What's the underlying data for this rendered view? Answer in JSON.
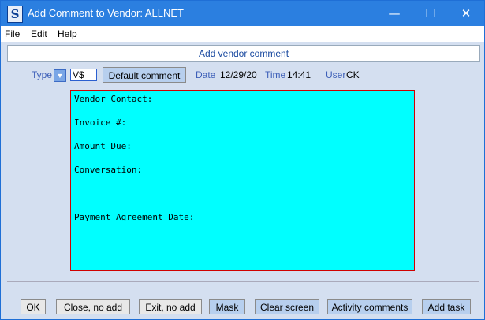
{
  "window": {
    "title": "Add Comment to Vendor:  ALLNET",
    "app_icon_letter": "S",
    "min_glyph": "—",
    "max_glyph": "☐",
    "close_glyph": "✕"
  },
  "menu": {
    "file": "File",
    "edit": "Edit",
    "help": "Help"
  },
  "header": {
    "label": "Add vendor comment"
  },
  "fields": {
    "type_label": "Type",
    "type_value": "V$",
    "default_comment_button": "Default comment",
    "date_label": "Date",
    "date_value": "12/29/20",
    "time_label": "Time",
    "time_value": "14:41",
    "user_label": "User",
    "user_value": "CK"
  },
  "comment": {
    "lines": [
      "Vendor Contact:",
      "Invoice #:",
      "Amount Due:",
      "Conversation:",
      "Payment Agreement Date:"
    ],
    "background": "#00ffff",
    "border": "#d00000"
  },
  "buttons": {
    "ok": "OK",
    "close_no_add": "Close, no add",
    "exit_no_add": "Exit, no add",
    "mask": "Mask",
    "clear_screen": "Clear screen",
    "activity_comments": "Activity comments",
    "add_task": "Add task"
  },
  "colors": {
    "title_bar": "#2b7fe0",
    "window_bg": "#d4dff0",
    "label_blue": "#3d5fb8",
    "button_blue": "#b7cfee"
  }
}
